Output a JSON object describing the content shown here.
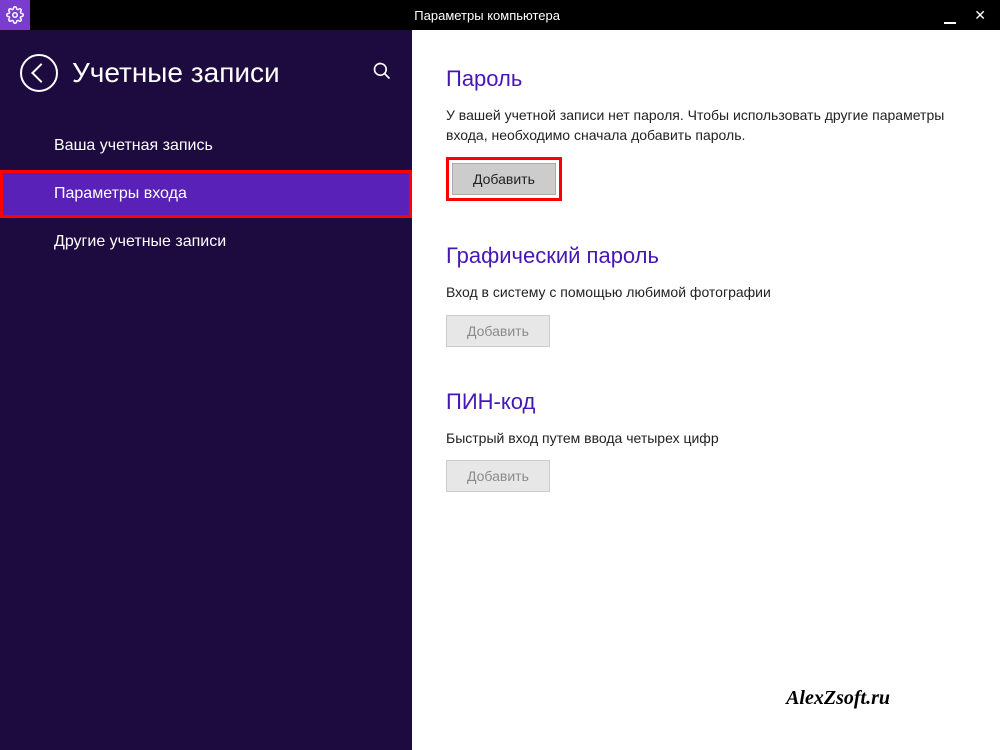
{
  "window": {
    "title": "Параметры компьютера"
  },
  "sidebar": {
    "title": "Учетные записи",
    "items": [
      {
        "label": "Ваша учетная запись",
        "selected": false
      },
      {
        "label": "Параметры входа",
        "selected": true
      },
      {
        "label": "Другие учетные записи",
        "selected": false
      }
    ]
  },
  "content": {
    "password": {
      "heading": "Пароль",
      "description": "У вашей учетной записи нет пароля. Чтобы использовать другие параметры входа, необходимо сначала добавить пароль.",
      "button": "Добавить"
    },
    "picture_password": {
      "heading": "Графический пароль",
      "description": "Вход в систему с помощью любимой фотографии",
      "button": "Добавить"
    },
    "pin": {
      "heading": "ПИН-код",
      "description": "Быстрый вход путем ввода четырех цифр",
      "button": "Добавить"
    }
  },
  "watermark": "AlexZsoft.ru"
}
